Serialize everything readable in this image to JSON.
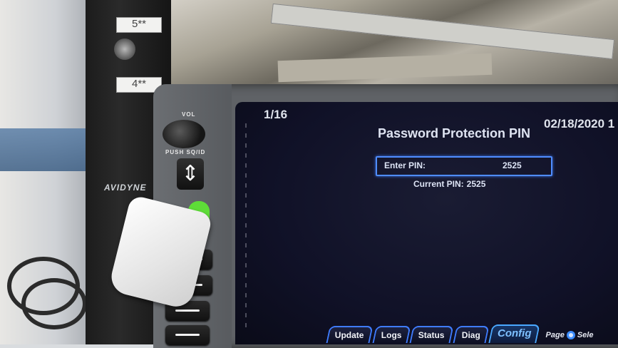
{
  "rack": {
    "label_top": "5**",
    "label_bottom": "4**"
  },
  "device": {
    "knob_top_label": "VOL",
    "knob_bottom_label": "PUSH SQ/ID",
    "brand": "AVIDYNE",
    "arrow_glyph": "⇕"
  },
  "screen": {
    "page_indicator": "1/16",
    "date": "02/18/2020 1",
    "title": "Password Protection PIN",
    "pin_field": {
      "label": "Enter PIN:",
      "value": "2525"
    },
    "current_pin": {
      "label": "Current PIN:",
      "value": "2525"
    },
    "tabs": [
      {
        "label": "Update",
        "active": false
      },
      {
        "label": "Logs",
        "active": false
      },
      {
        "label": "Status",
        "active": false
      },
      {
        "label": "Diag",
        "active": false
      },
      {
        "label": "Config",
        "active": true
      }
    ],
    "page_hint_prefix": "Page",
    "page_hint_suffix": "Sele",
    "accent_color": "#3f7cff",
    "active_tab_color": "#7ec0ff",
    "usb_led_color": "#5edc38"
  }
}
